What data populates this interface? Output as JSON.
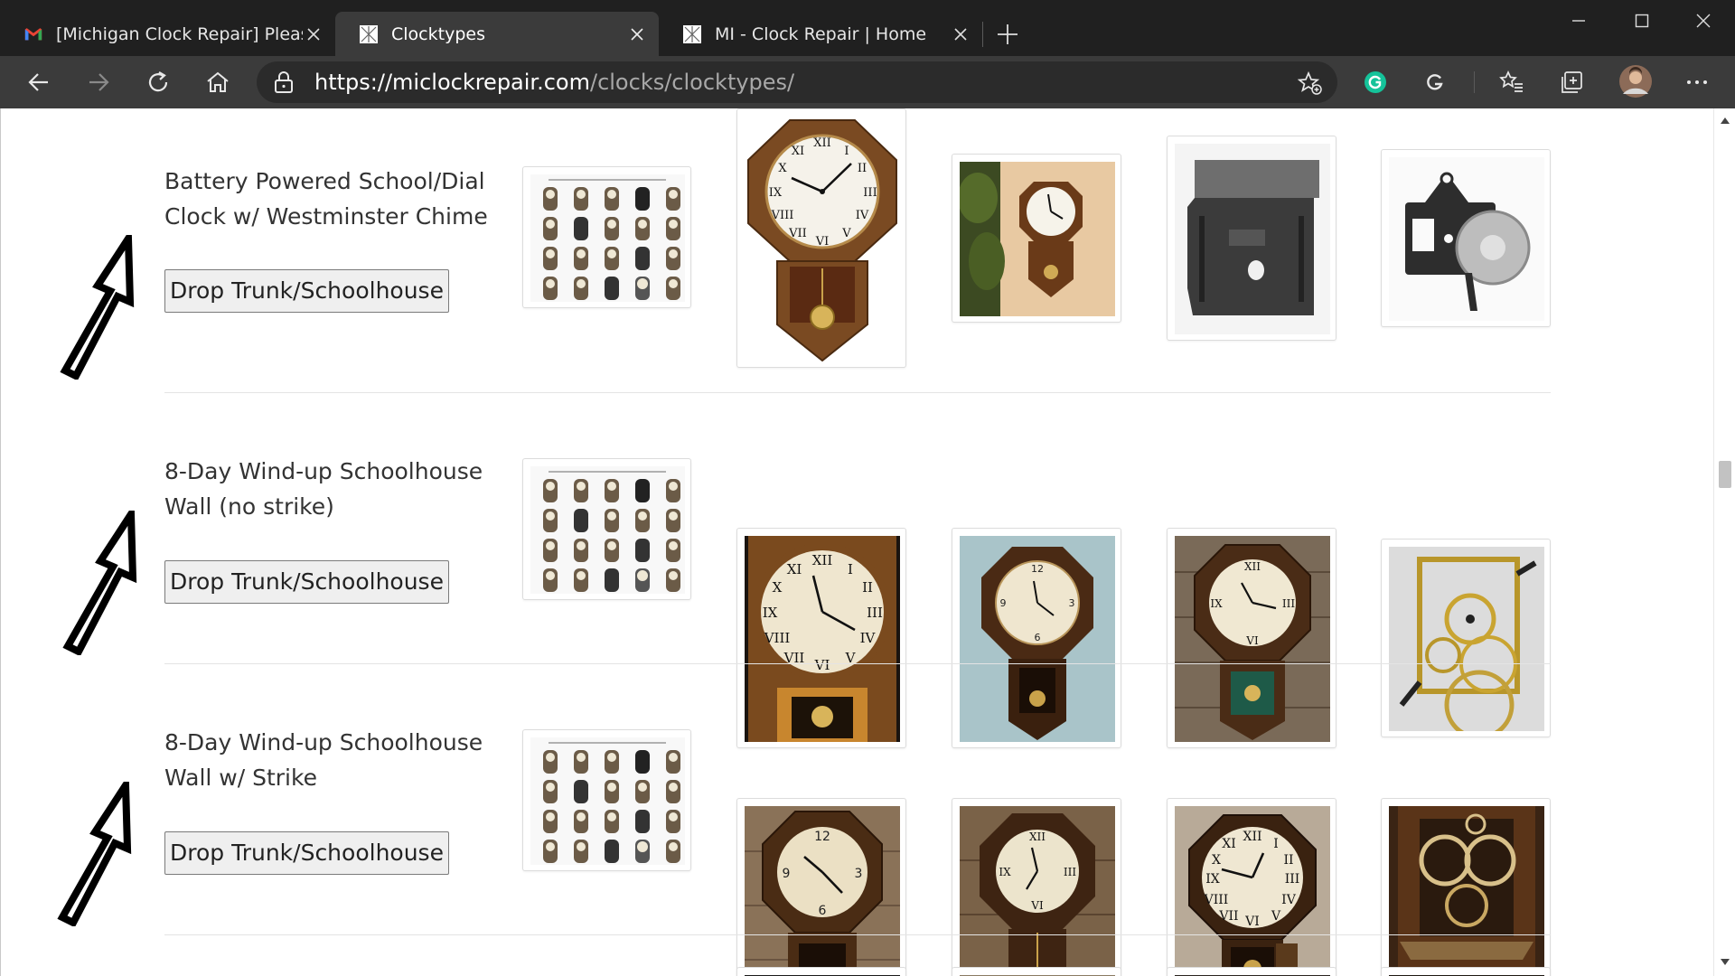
{
  "browser": {
    "tabs": [
      {
        "title": "[Michigan Clock Repair] Please C",
        "favicon": "gmail-icon"
      },
      {
        "title": "Clocktypes",
        "favicon": "site-icon",
        "active": true
      },
      {
        "title": "MI - Clock Repair | Home",
        "favicon": "site-icon"
      }
    ],
    "url_host": "https://miclockrepair.com",
    "url_path": "/clocks/clocktypes/"
  },
  "sections": [
    {
      "title": "Battery Powered School/Dial Clock w/ Westminster Chime",
      "button": "Drop Trunk/Schoolhouse"
    },
    {
      "title": "8-Day Wind-up Schoolhouse Wall (no strike)",
      "button": "Drop Trunk/Schoolhouse"
    },
    {
      "title": "8-Day Wind-up Schoolhouse Wall w/ Strike",
      "button": "Drop Trunk/Schoolhouse"
    }
  ],
  "colors": {
    "chrome_dark": "#202020",
    "chrome_bar": "#3b3b3b",
    "wood": "#7a4a22",
    "dial": "#f2eee2"
  }
}
